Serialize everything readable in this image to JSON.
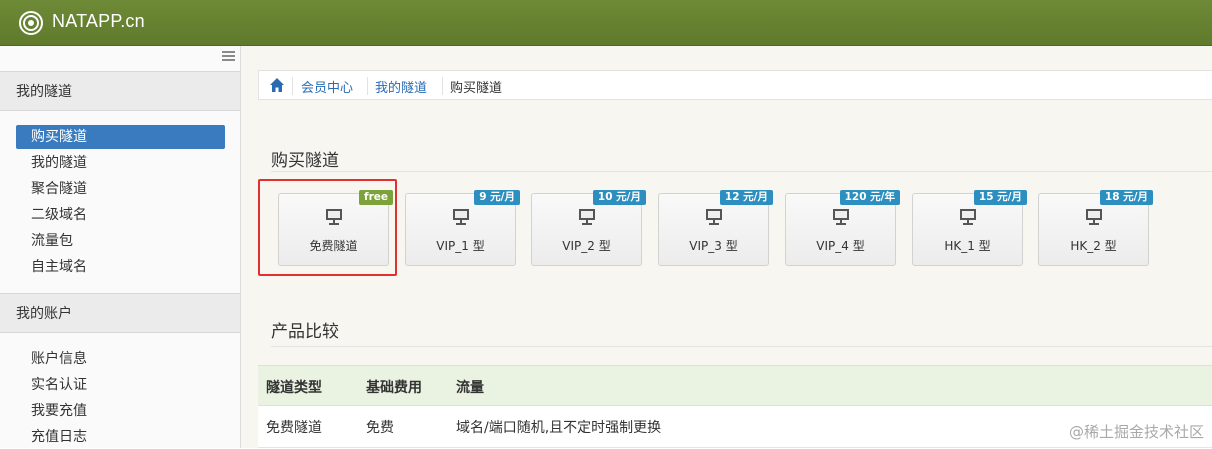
{
  "app": {
    "brand": "NATAPP.cn"
  },
  "sidebar": {
    "groups": [
      {
        "title": "我的隧道",
        "items": [
          "购买隧道",
          "我的隧道",
          "聚合隧道",
          "二级域名",
          "流量包",
          "自主域名"
        ]
      },
      {
        "title": "我的账户",
        "items": [
          "账户信息",
          "实名认证",
          "我要充值",
          "充值日志"
        ]
      }
    ],
    "active_item": "购买隧道"
  },
  "breadcrumb": {
    "items": [
      "会员中心",
      "我的隧道"
    ],
    "current": "购买隧道"
  },
  "buy": {
    "title": "购买隧道",
    "cards": [
      {
        "name": "免费隧道",
        "price": "free"
      },
      {
        "name": "VIP_1 型",
        "price": "9 元/月"
      },
      {
        "name": "VIP_2 型",
        "price": "10 元/月"
      },
      {
        "name": "VIP_3 型",
        "price": "12 元/月"
      },
      {
        "name": "VIP_4 型",
        "price": "120 元/年"
      },
      {
        "name": "HK_1 型",
        "price": "15 元/月"
      },
      {
        "name": "HK_2 型",
        "price": "18 元/月"
      }
    ]
  },
  "compare": {
    "title": "产品比较",
    "columns": [
      "隧道类型",
      "基础费用",
      "流量"
    ],
    "rows": [
      [
        "免费隧道",
        "免费",
        "域名/端口随机,且不定时强制更换"
      ]
    ]
  },
  "watermark": "@稀土掘金技术社区",
  "colors": {
    "topbar": "#6e8a37",
    "active": "#3a7bbf",
    "price_tag": "#2d8fbf",
    "free_tag": "#7da23a",
    "highlight": "#e03131"
  }
}
